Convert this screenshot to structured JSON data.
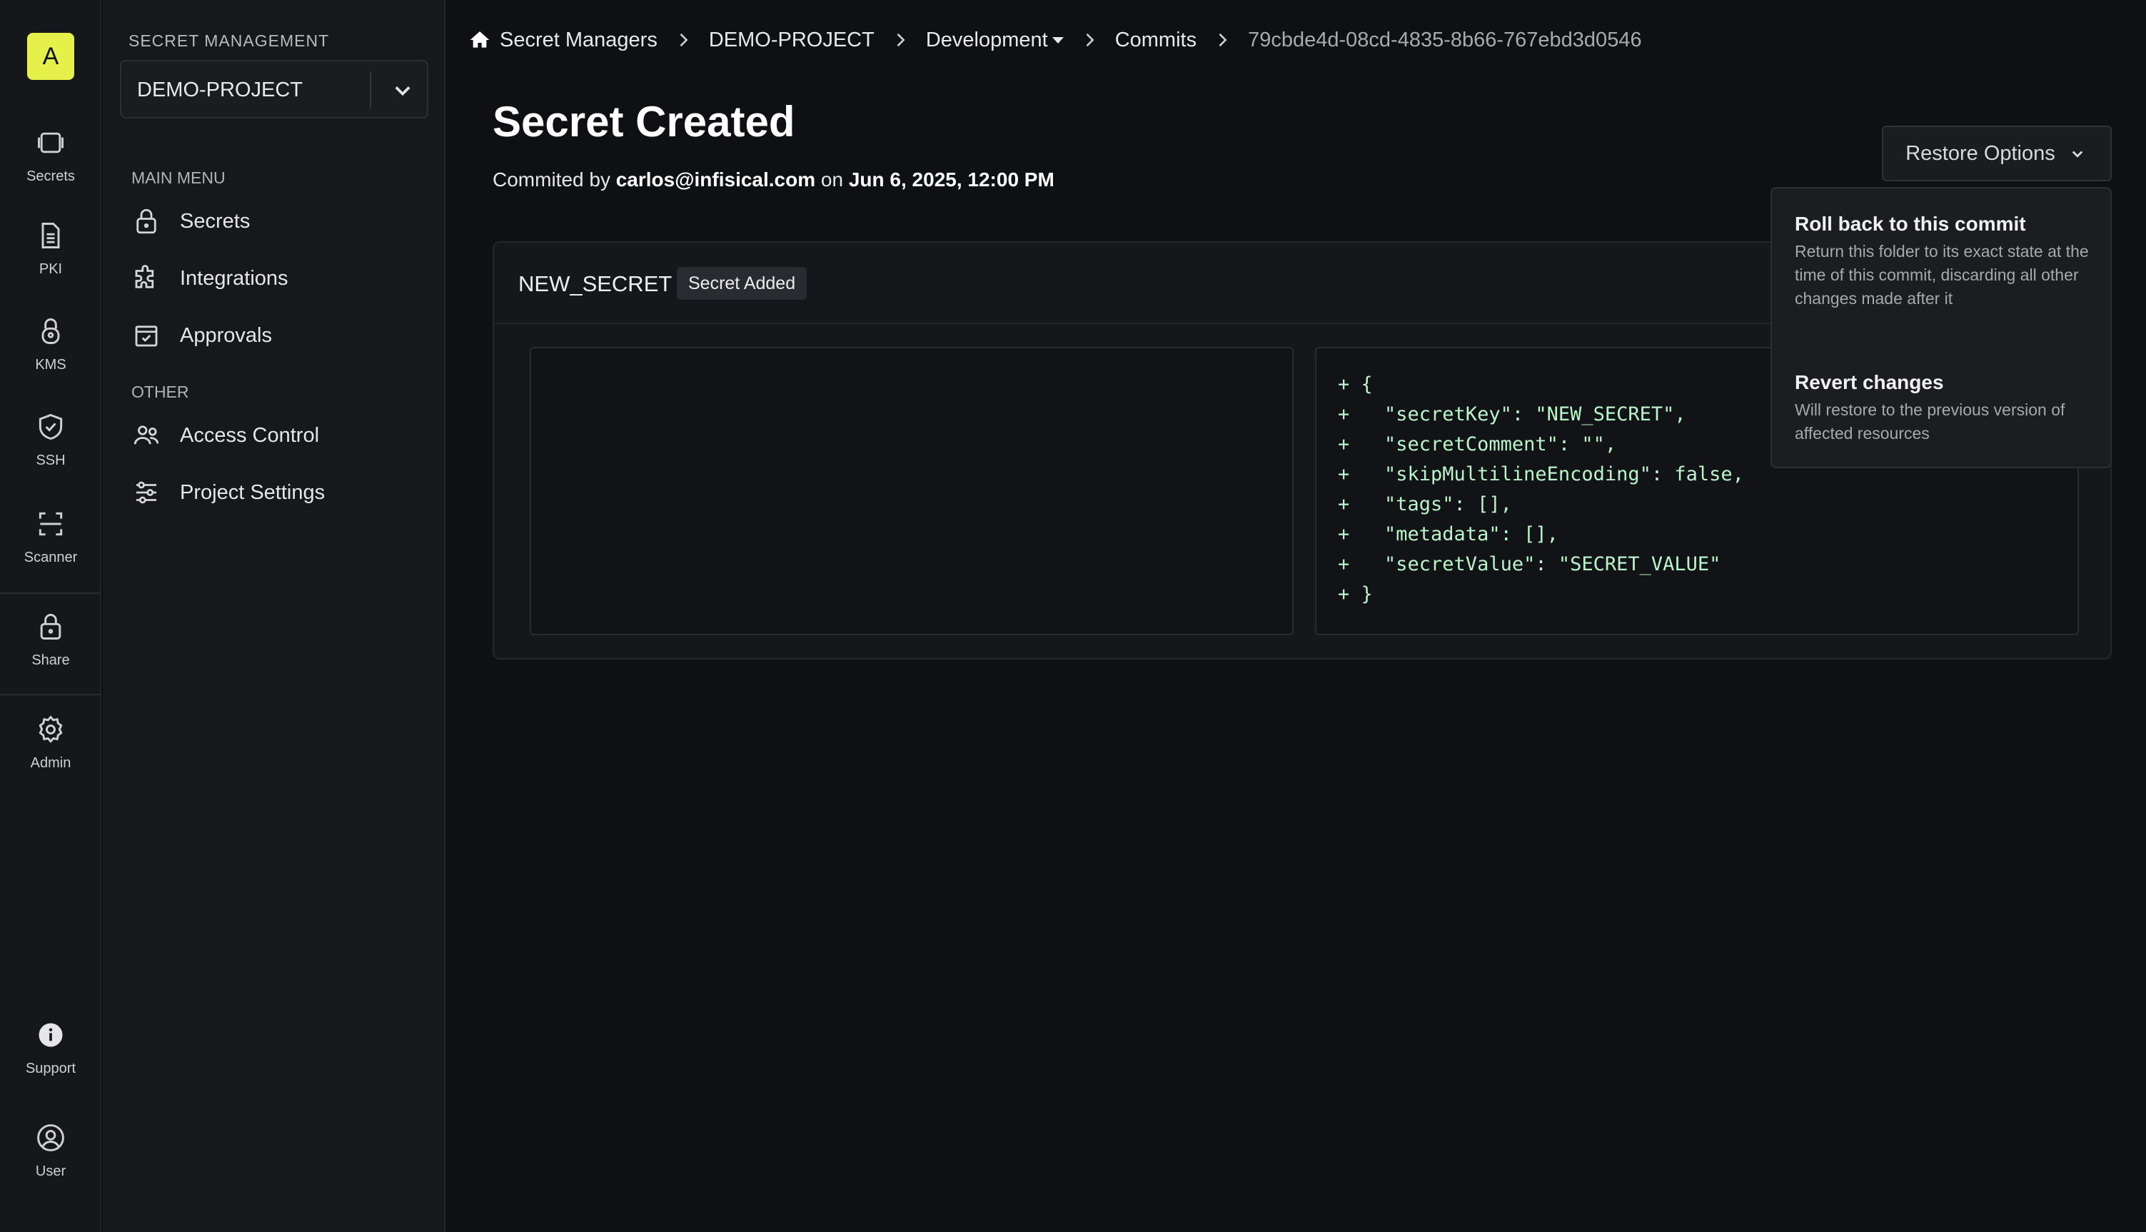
{
  "rail": {
    "logo": "A",
    "items": [
      {
        "label": "Secrets",
        "icon": "vault-icon"
      },
      {
        "label": "PKI",
        "icon": "document-icon"
      },
      {
        "label": "KMS",
        "icon": "lock-key-icon"
      },
      {
        "label": "SSH",
        "icon": "shield-icon"
      },
      {
        "label": "Scanner",
        "icon": "scan-icon"
      },
      {
        "label": "Share",
        "icon": "lock-icon"
      },
      {
        "label": "Admin",
        "icon": "gear-icon"
      },
      {
        "label": "Support",
        "icon": "info-icon"
      },
      {
        "label": "User",
        "icon": "user-icon"
      }
    ]
  },
  "sidebar": {
    "heading": "SECRET MANAGEMENT",
    "project_select": "DEMO-PROJECT",
    "main_menu_label": "MAIN MENU",
    "main_items": [
      "Secrets",
      "Integrations",
      "Approvals"
    ],
    "other_label": "OTHER",
    "other_items": [
      "Access Control",
      "Project Settings"
    ]
  },
  "breadcrumb": {
    "home": "Secret Managers",
    "project": "DEMO-PROJECT",
    "env": "Development",
    "commits": "Commits",
    "commit_id": "79cbde4d-08cd-4835-8b66-767ebd3d0546"
  },
  "page": {
    "title": "Secret Created",
    "committed_prefix": "Commited by",
    "author": "carlos@infisical.com",
    "on_word": "on",
    "date": "Jun 6, 2025, 12:00 PM"
  },
  "restore": {
    "button_label": "Restore Options",
    "menu": [
      {
        "title": "Roll back to this commit",
        "desc": "Return this folder to its exact state at the time of this commit, discarding all other changes made after it"
      },
      {
        "title": "Revert changes",
        "desc": "Will restore to the previous version of affected resources"
      }
    ]
  },
  "card": {
    "secret_name": "NEW_SECRET",
    "badge": "Secret Added",
    "diff_lines": [
      "+ {",
      "+   \"secretKey\": \"NEW_SECRET\",",
      "+   \"secretComment\": \"\",",
      "+   \"skipMultilineEncoding\": false,",
      "+   \"tags\": [],",
      "+   \"metadata\": [],",
      "+   \"secretValue\": \"SECRET_VALUE\"",
      "+ }"
    ]
  },
  "colors": {
    "accent_logo": "#e6f04a",
    "diff_added": "#b9f5c9",
    "background": "#0f1013"
  }
}
